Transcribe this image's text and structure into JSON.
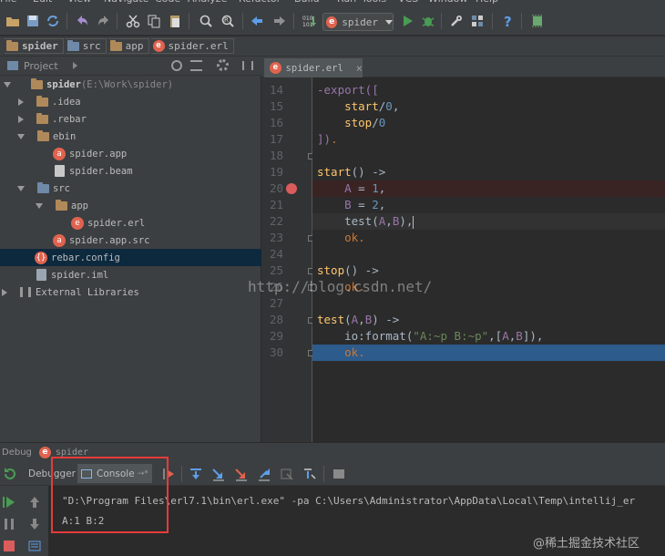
{
  "menu": [
    "File",
    "Edit",
    "View",
    "Navigate",
    "Code",
    "Analyze",
    "Refactor",
    "Build",
    "Run",
    "Tools",
    "VCS",
    "Window",
    "Help"
  ],
  "toolbar": {
    "run_config": "spider",
    "run_config_badge": "e"
  },
  "breadcrumbs": [
    {
      "label": "spider",
      "icon": "folder-icon"
    },
    {
      "label": "src",
      "icon": "folder-icon"
    },
    {
      "label": "app",
      "icon": "folder-icon"
    },
    {
      "label": "spider.erl",
      "icon": "erlang-file-icon"
    }
  ],
  "project_panel": {
    "title": "Project",
    "tree": [
      {
        "label": "spider",
        "path": " (E:\\Work\\spider)",
        "expanded": true,
        "icon": "folder-icon"
      },
      {
        "label": ".idea",
        "expanded": false,
        "icon": "folder-icon"
      },
      {
        "label": ".rebar",
        "expanded": false,
        "icon": "folder-icon"
      },
      {
        "label": "ebin",
        "expanded": true,
        "icon": "folder-icon"
      },
      {
        "label": "spider.app",
        "icon": "erlang-app-icon"
      },
      {
        "label": "spider.beam",
        "icon": "file-icon"
      },
      {
        "label": "src",
        "expanded": true,
        "icon": "source-folder-icon"
      },
      {
        "label": "app",
        "expanded": true,
        "icon": "folder-icon"
      },
      {
        "label": "spider.erl",
        "icon": "erlang-file-icon"
      },
      {
        "label": "spider.app.src",
        "icon": "erlang-app-icon"
      },
      {
        "label": "rebar.config",
        "icon": "rebar-config-icon",
        "selected": true
      },
      {
        "label": "spider.iml",
        "icon": "iml-file-icon"
      },
      {
        "label": "External Libraries",
        "expanded": false,
        "icon": "library-icon"
      }
    ]
  },
  "editor": {
    "tab": {
      "label": "spider.erl",
      "close": "×"
    },
    "lines": [
      {
        "n": "14",
        "tokens": [
          [
            "at",
            "-export(["
          ]
        ]
      },
      {
        "n": "15",
        "tokens": [
          [
            "plain",
            "    "
          ],
          [
            "fn",
            "start"
          ],
          [
            "plain",
            "/"
          ],
          [
            "nm",
            "0"
          ],
          [
            "plain",
            ","
          ]
        ]
      },
      {
        "n": "16",
        "tokens": [
          [
            "plain",
            "    "
          ],
          [
            "fn",
            "stop"
          ],
          [
            "plain",
            "/"
          ],
          [
            "nm",
            "0"
          ]
        ]
      },
      {
        "n": "17",
        "tokens": [
          [
            "at",
            "])"
          ],
          [
            "kw",
            "."
          ]
        ]
      },
      {
        "n": "18",
        "tokens": []
      },
      {
        "n": "19",
        "tokens": [
          [
            "fn",
            "start"
          ],
          [
            "plain",
            "() ->"
          ]
        ]
      },
      {
        "n": "20",
        "tokens": [
          [
            "plain",
            "    "
          ],
          [
            "at",
            "A"
          ],
          [
            "plain",
            " = "
          ],
          [
            "nm",
            "1"
          ],
          [
            "plain",
            ","
          ]
        ],
        "breakpoint": true
      },
      {
        "n": "21",
        "tokens": [
          [
            "plain",
            "    "
          ],
          [
            "at",
            "B"
          ],
          [
            "plain",
            " = "
          ],
          [
            "nm",
            "2"
          ],
          [
            "plain",
            ","
          ]
        ]
      },
      {
        "n": "22",
        "tokens": [
          [
            "plain",
            "    "
          ],
          [
            "plain",
            "test("
          ],
          [
            "at",
            "A"
          ],
          [
            "plain",
            ","
          ],
          [
            "at",
            "B"
          ],
          [
            "plain",
            "),"
          ]
        ],
        "bulb": true,
        "caret": true
      },
      {
        "n": "23",
        "tokens": [
          [
            "plain",
            "    "
          ],
          [
            "kw",
            "ok."
          ]
        ]
      },
      {
        "n": "24",
        "tokens": []
      },
      {
        "n": "25",
        "tokens": [
          [
            "fn",
            "stop"
          ],
          [
            "plain",
            "() ->"
          ]
        ]
      },
      {
        "n": "26",
        "tokens": [
          [
            "plain",
            "    "
          ],
          [
            "kw",
            "ok."
          ]
        ]
      },
      {
        "n": "27",
        "tokens": []
      },
      {
        "n": "28",
        "tokens": [
          [
            "fn",
            "test"
          ],
          [
            "plain",
            "("
          ],
          [
            "at",
            "A"
          ],
          [
            "plain",
            ","
          ],
          [
            "at",
            "B"
          ],
          [
            "plain",
            ") ->"
          ]
        ]
      },
      {
        "n": "29",
        "tokens": [
          [
            "plain",
            "    io:format("
          ],
          [
            "st",
            "\"A:~p B:~p\""
          ],
          [
            "plain",
            ",["
          ],
          [
            "at",
            "A"
          ],
          [
            "plain",
            ","
          ],
          [
            "at",
            "B"
          ],
          [
            "plain",
            "]),"
          ]
        ]
      },
      {
        "n": "30",
        "tokens": [
          [
            "plain",
            "    "
          ],
          [
            "kw",
            "ok."
          ]
        ],
        "execution": true
      }
    ]
  },
  "watermark": "http://blog.csdn.net/",
  "debug": {
    "title_prefix": "Debug",
    "title_config": "spider",
    "tabs": {
      "debugger": "Debugger",
      "console": "Console",
      "console_suffix": "→*"
    },
    "console_lines": [
      "\"D:\\Program Files\\erl7.1\\bin\\erl.exe\" -pa C:\\Users\\Administrator\\AppData\\Local\\Temp\\intellij_er",
      "A:1 B:2"
    ]
  },
  "corner_watermark": "@稀土掘金技术社区",
  "colors": {
    "accent_run": "#499c54",
    "breakpoint": "#db5c5c",
    "execution_line": "#2d5b8c",
    "highlight_box": "#e63b3b"
  }
}
